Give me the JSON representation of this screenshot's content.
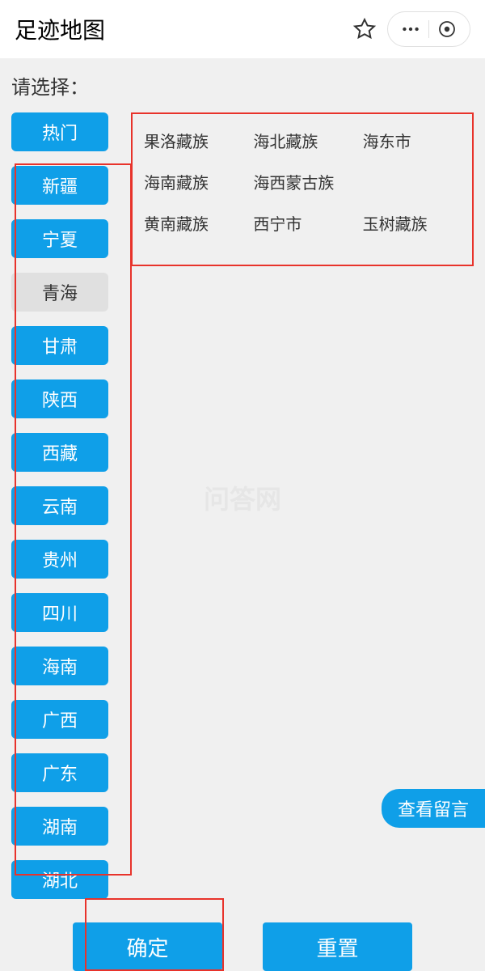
{
  "header": {
    "title": "足迹地图"
  },
  "prompt": "请选择：",
  "provinces": {
    "hot": "热门",
    "items": [
      "新疆",
      "宁夏",
      "青海",
      "甘肃",
      "陕西",
      "西藏",
      "云南",
      "贵州",
      "四川",
      "海南",
      "广西",
      "广东",
      "湖南",
      "湖北"
    ],
    "selected": "青海"
  },
  "cities": [
    "果洛藏族",
    "海北藏族",
    "海东市",
    "海南藏族",
    "海西蒙古族",
    "黄南藏族",
    "西宁市",
    "玉树藏族"
  ],
  "layout": {
    "city_last_row_indices": [
      5,
      6,
      7
    ]
  },
  "watermark": "问答网",
  "view_comments": "查看留言",
  "footer": {
    "confirm": "确定",
    "reset": "重置"
  }
}
